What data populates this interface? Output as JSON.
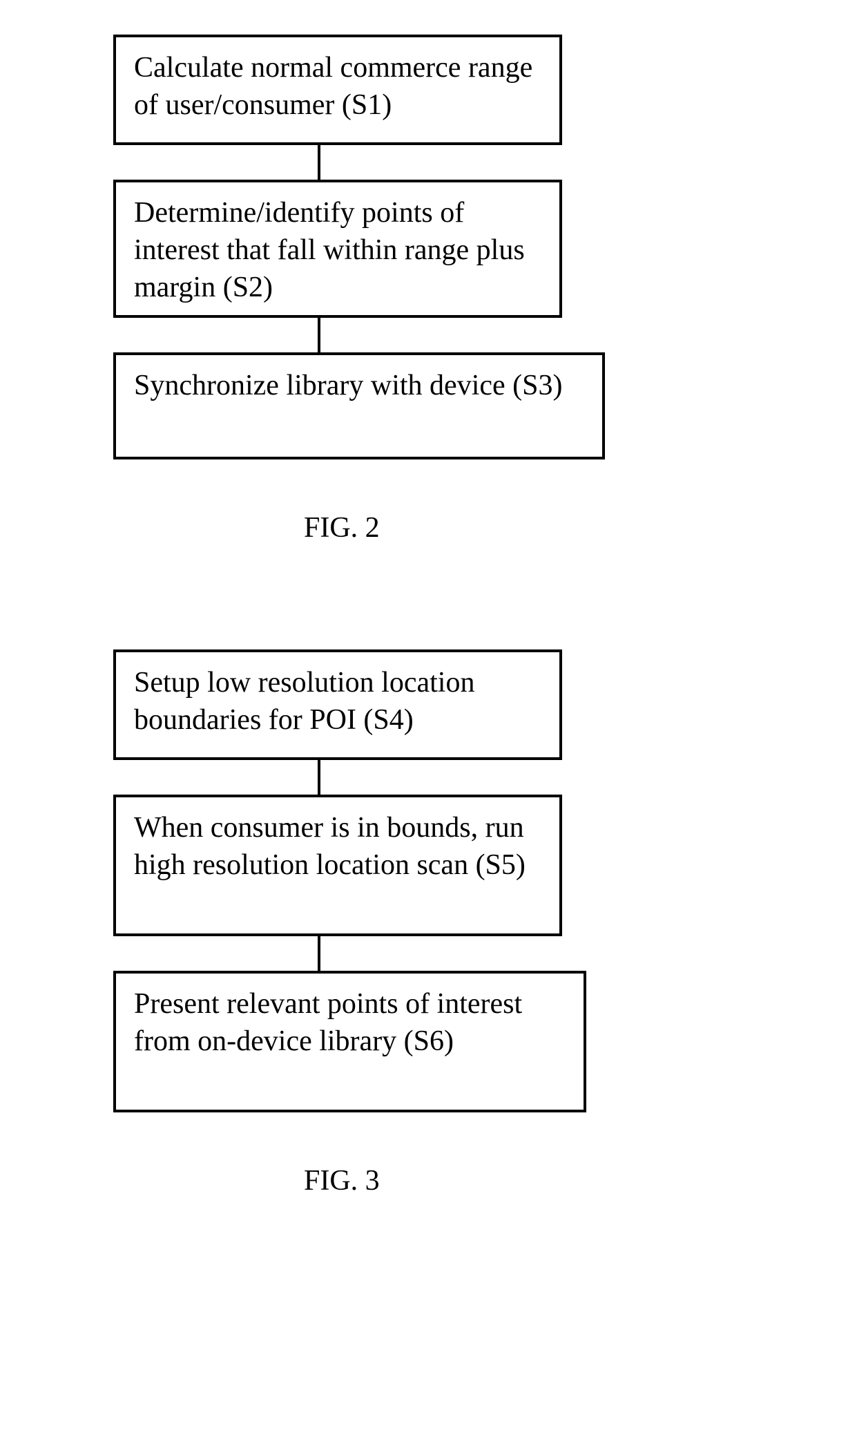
{
  "fig2": {
    "s1": "Calculate normal commerce range of user/consumer (S1)",
    "s2": "Determine/identify points of interest that fall within range plus margin (S2)",
    "s3": "Synchronize library with device (S3)",
    "label": "FIG. 2"
  },
  "fig3": {
    "s4": "Setup low resolution location boundaries for POI (S4)",
    "s5": "When consumer is in bounds, run high resolution location scan (S5)",
    "s6": "Present relevant points of interest from on-device library (S6)",
    "label": "FIG. 3"
  }
}
